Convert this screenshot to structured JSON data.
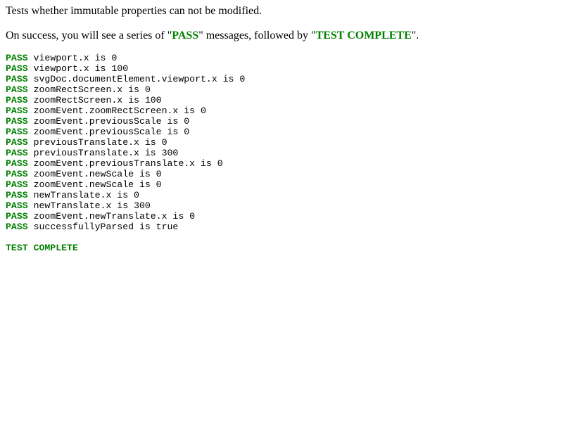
{
  "description": {
    "line1": "Tests whether immutable properties can not be modified.",
    "line2_prefix": "On success, you will see a series of \"",
    "line2_pass": "PASS",
    "line2_middle": "\" messages, followed by \"",
    "line2_complete": "TEST COMPLETE",
    "line2_suffix": "\"."
  },
  "console": {
    "pass_label": "PASS",
    "results": [
      "viewport.x is 0",
      "viewport.x is 100",
      "svgDoc.documentElement.viewport.x is 0",
      "zoomRectScreen.x is 0",
      "zoomRectScreen.x is 100",
      "zoomEvent.zoomRectScreen.x is 0",
      "zoomEvent.previousScale is 0",
      "zoomEvent.previousScale is 0",
      "previousTranslate.x is 0",
      "previousTranslate.x is 300",
      "zoomEvent.previousTranslate.x is 0",
      "zoomEvent.newScale is 0",
      "zoomEvent.newScale is 0",
      "newTranslate.x is 0",
      "newTranslate.x is 300",
      "zoomEvent.newTranslate.x is 0",
      "successfullyParsed is true"
    ],
    "complete_label": "TEST COMPLETE"
  },
  "colors": {
    "pass": "#008000",
    "text": "#000000",
    "background": "#ffffff"
  }
}
